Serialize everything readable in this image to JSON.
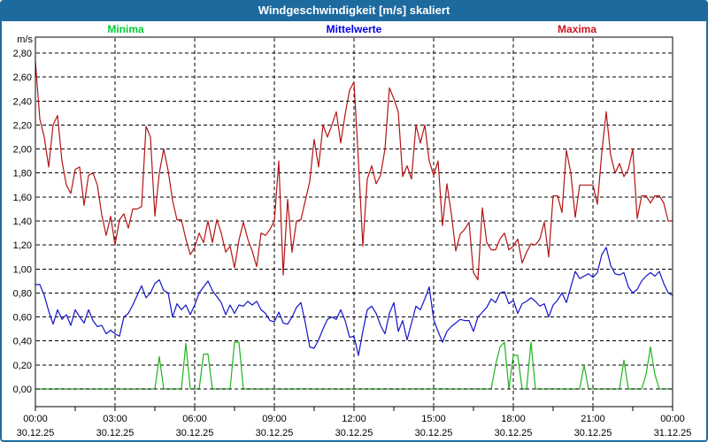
{
  "window": {
    "title": "Windgeschwindigkeit [m/s] skaliert"
  },
  "colors": {
    "titlebar_bg": "#1D6A9F",
    "frame_border": "#1D6A9F",
    "grid": "#000000",
    "axis_text": "#000000",
    "minima_line": "#1EB41E",
    "mittelwerte_line": "#1414C8",
    "maxima_line": "#B41414",
    "legend_minima": "#00CC33",
    "legend_mittelwerte": "#0000E6",
    "legend_maxima": "#CC1422"
  },
  "legend": {
    "items": [
      {
        "id": "minima",
        "label": "Minima",
        "color": "#00CC33"
      },
      {
        "id": "mittelwerte",
        "label": "Mittelwerte",
        "color": "#0000E6"
      },
      {
        "id": "maxima",
        "label": "Maxima",
        "color": "#CC1422"
      }
    ]
  },
  "y_axis": {
    "unit": "m/s",
    "tick_labels": [
      "2,80",
      "2,60",
      "2,40",
      "2,20",
      "2,00",
      "1,80",
      "1,60",
      "1,40",
      "1,20",
      "1,00",
      "0,80",
      "0,60",
      "0,40",
      "0,20",
      "0,00"
    ]
  },
  "x_axis": {
    "labels": [
      {
        "time": "00:00",
        "date": "30.12.25"
      },
      {
        "time": "03:00",
        "date": "30.12.25"
      },
      {
        "time": "06:00",
        "date": "30.12.25"
      },
      {
        "time": "09:00",
        "date": "30.12.25"
      },
      {
        "time": "12:00",
        "date": "30.12.25"
      },
      {
        "time": "15:00",
        "date": "30.12.25"
      },
      {
        "time": "18:00",
        "date": "30.12.25"
      },
      {
        "time": "21:00",
        "date": "30.12.25"
      },
      {
        "time": "00:00",
        "date": "31.12.25"
      }
    ]
  },
  "chart_data": {
    "type": "line",
    "title": "Windgeschwindigkeit [m/s] skaliert",
    "xlabel": "",
    "ylabel": "m/s",
    "ylim": [
      0,
      2.8
    ],
    "y_step": 0.2,
    "x_unit": "minutes",
    "x_start": 0,
    "x_step": 10,
    "x_end": 1440,
    "grid": "dashed",
    "legend_position": "top",
    "series": [
      {
        "name": "Maxima",
        "color": "#B41414",
        "values": [
          2.73,
          2.25,
          2.1,
          1.85,
          2.2,
          2.28,
          1.9,
          1.7,
          1.63,
          1.83,
          1.85,
          1.53,
          1.78,
          1.8,
          1.7,
          1.45,
          1.28,
          1.44,
          1.2,
          1.41,
          1.46,
          1.34,
          1.5,
          1.5,
          1.52,
          2.19,
          2.1,
          1.44,
          1.8,
          2.0,
          1.82,
          1.57,
          1.41,
          1.41,
          1.25,
          1.12,
          1.18,
          1.3,
          1.22,
          1.4,
          1.22,
          1.41,
          1.3,
          1.14,
          1.19,
          1.01,
          1.24,
          1.39,
          1.25,
          1.15,
          1.02,
          1.3,
          1.28,
          1.33,
          1.4,
          1.9,
          0.95,
          1.58,
          1.14,
          1.4,
          1.41,
          1.57,
          1.73,
          2.08,
          1.85,
          2.2,
          2.1,
          2.2,
          2.31,
          2.05,
          2.29,
          2.49,
          2.56,
          1.9,
          1.19,
          1.75,
          1.86,
          1.71,
          1.78,
          2.0,
          2.51,
          2.42,
          2.31,
          1.77,
          1.86,
          1.75,
          2.2,
          2.05,
          2.2,
          1.9,
          1.78,
          1.9,
          1.36,
          1.71,
          1.46,
          1.15,
          1.29,
          1.33,
          1.39,
          0.97,
          0.91,
          1.51,
          1.22,
          1.16,
          1.16,
          1.25,
          1.3,
          1.16,
          1.19,
          1.25,
          1.05,
          1.14,
          1.21,
          1.2,
          1.25,
          1.39,
          1.1,
          1.61,
          1.61,
          1.47,
          1.99,
          1.8,
          1.43,
          1.7,
          1.7,
          1.7,
          1.7,
          1.54,
          1.97,
          2.31,
          1.95,
          1.8,
          1.88,
          1.77,
          1.83,
          2.0,
          1.42,
          1.61,
          1.61,
          1.55,
          1.61,
          1.61,
          1.55,
          1.4,
          1.4
        ]
      },
      {
        "name": "Mittelwerte",
        "color": "#1414C8",
        "values": [
          0.87,
          0.87,
          0.78,
          0.65,
          0.54,
          0.66,
          0.58,
          0.62,
          0.53,
          0.66,
          0.6,
          0.55,
          0.66,
          0.57,
          0.52,
          0.53,
          0.46,
          0.49,
          0.46,
          0.44,
          0.6,
          0.63,
          0.7,
          0.78,
          0.86,
          0.76,
          0.8,
          0.88,
          0.91,
          0.82,
          0.8,
          0.6,
          0.71,
          0.66,
          0.7,
          0.62,
          0.7,
          0.8,
          0.85,
          0.9,
          0.82,
          0.77,
          0.72,
          0.62,
          0.7,
          0.63,
          0.7,
          0.69,
          0.73,
          0.7,
          0.73,
          0.66,
          0.63,
          0.57,
          0.56,
          0.64,
          0.55,
          0.54,
          0.6,
          0.68,
          0.72,
          0.55,
          0.35,
          0.34,
          0.41,
          0.5,
          0.58,
          0.6,
          0.58,
          0.66,
          0.57,
          0.43,
          0.44,
          0.28,
          0.48,
          0.66,
          0.69,
          0.63,
          0.53,
          0.46,
          0.63,
          0.72,
          0.48,
          0.57,
          0.41,
          0.55,
          0.69,
          0.66,
          0.75,
          0.85,
          0.58,
          0.48,
          0.39,
          0.48,
          0.52,
          0.55,
          0.58,
          0.57,
          0.57,
          0.48,
          0.6,
          0.64,
          0.68,
          0.75,
          0.72,
          0.8,
          0.81,
          0.71,
          0.74,
          0.63,
          0.71,
          0.73,
          0.76,
          0.73,
          0.69,
          0.71,
          0.6,
          0.7,
          0.74,
          0.8,
          0.72,
          0.85,
          0.98,
          0.92,
          0.94,
          0.96,
          0.93,
          0.97,
          1.12,
          1.18,
          1.03,
          0.96,
          0.95,
          0.97,
          0.85,
          0.8,
          0.83,
          0.9,
          0.94,
          0.97,
          0.94,
          0.98,
          0.88,
          0.8,
          0.78
        ]
      },
      {
        "name": "Minima",
        "color": "#1EB41E",
        "values": [
          0,
          0,
          0,
          0,
          0,
          0,
          0,
          0,
          0,
          0,
          0,
          0,
          0,
          0,
          0,
          0,
          0,
          0,
          0,
          0,
          0,
          0,
          0,
          0,
          0,
          0,
          0,
          0,
          0.27,
          0,
          0,
          0,
          0,
          0,
          0.38,
          0,
          0,
          0,
          0.29,
          0.29,
          0,
          0,
          0,
          0,
          0,
          0.39,
          0.39,
          0,
          0,
          0,
          0,
          0,
          0,
          0,
          0,
          0,
          0,
          0,
          0,
          0,
          0,
          0,
          0,
          0,
          0,
          0,
          0,
          0,
          0,
          0,
          0,
          0,
          0,
          0,
          0,
          0,
          0,
          0,
          0,
          0,
          0,
          0,
          0,
          0,
          0,
          0,
          0,
          0,
          0,
          0,
          0,
          0,
          0,
          0,
          0,
          0,
          0,
          0,
          0,
          0,
          0,
          0,
          0,
          0,
          0.2,
          0.35,
          0.39,
          0,
          0.28,
          0.28,
          0,
          0,
          0.39,
          0,
          0,
          0,
          0,
          0,
          0,
          0,
          0,
          0,
          0,
          0,
          0.2,
          0,
          0,
          0,
          0,
          0,
          0,
          0,
          0,
          0.24,
          0,
          0,
          0,
          0,
          0.12,
          0.35,
          0.12,
          0,
          0,
          0,
          0
        ]
      }
    ]
  }
}
